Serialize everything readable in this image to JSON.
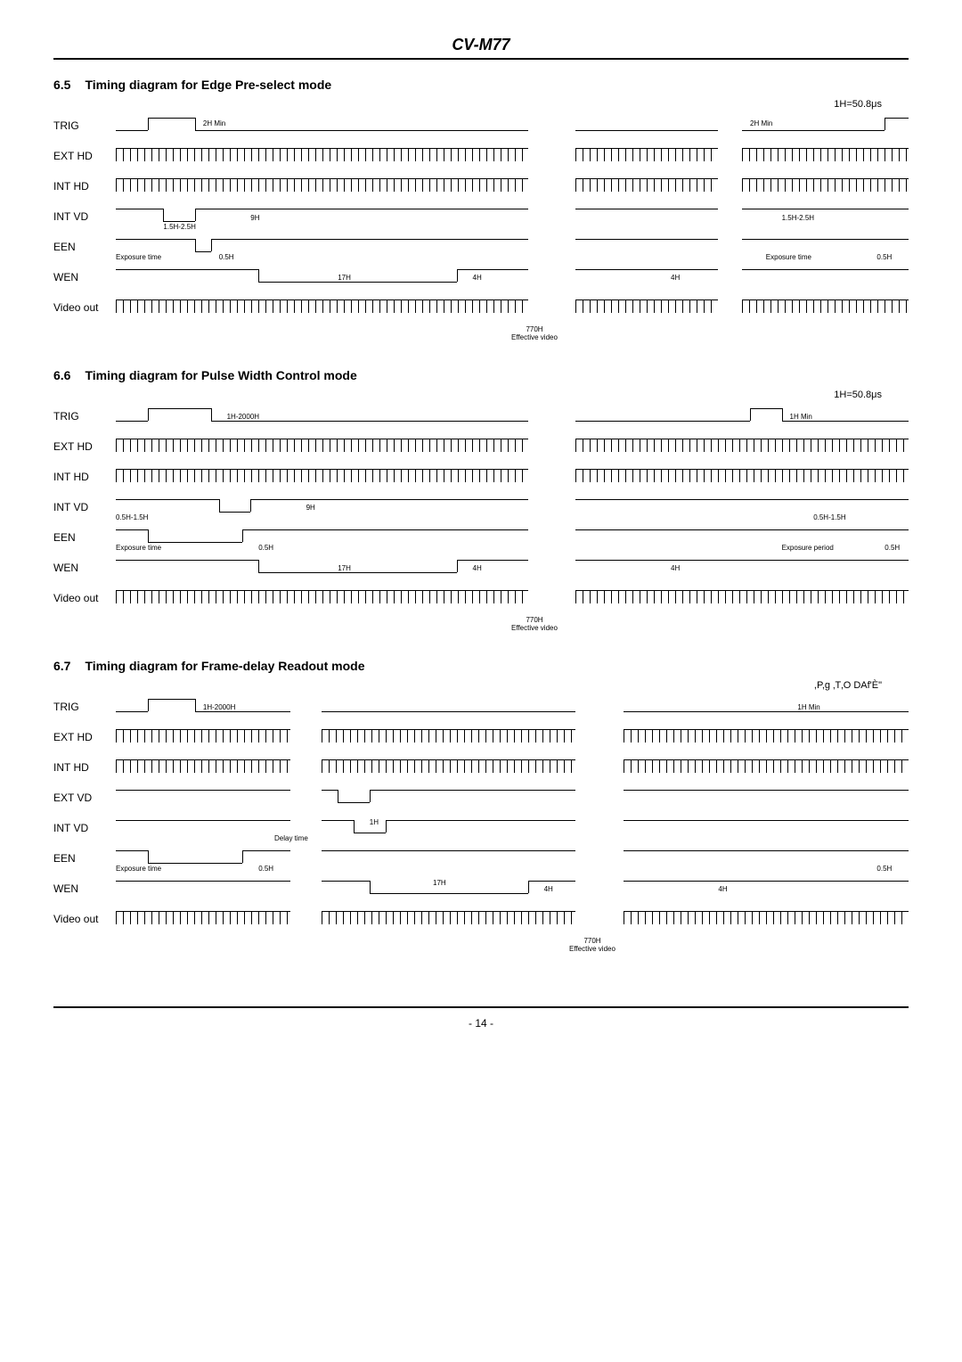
{
  "doc_title": "CV-M77",
  "page_num": "- 14 -",
  "unit_label_1": "1H=50.8μs",
  "unit_label_2": "1H=50.8μs",
  "unit_label_3": ",P,g     ‚T‚O  DAf'È\"",
  "section_65": {
    "num": "6.5",
    "title": "Timing diagram for Edge Pre-select mode"
  },
  "section_66": {
    "num": "6.6",
    "title": "Timing diagram for Pulse Width Control mode"
  },
  "section_67": {
    "num": "6.7",
    "title": "Timing diagram for Frame-delay Readout mode"
  },
  "signals": {
    "trig": "TRIG",
    "exthd": "EXT HD",
    "inthd": "INT HD",
    "intvd": "INT VD",
    "extvd": "EXT VD",
    "een": "EEN",
    "wen": "WEN",
    "video": "Video out"
  },
  "anno": {
    "2hmin": "2H Min",
    "1_5_2_5h": "1.5H-2.5H",
    "9h": "9H",
    "exposure_time": "Exposure time",
    "exposure_period": "Exposure period",
    "0_5h": "0.5H",
    "17h": "17H",
    "4h": "4H",
    "770h": "770H",
    "eff_video": "Effective video",
    "1h_2000h": "1H-2000H",
    "1hmin": "1H Min",
    "0_5_1_5h": "0.5H-1.5H",
    "delay_time": "Delay time",
    "1h": "1H"
  }
}
